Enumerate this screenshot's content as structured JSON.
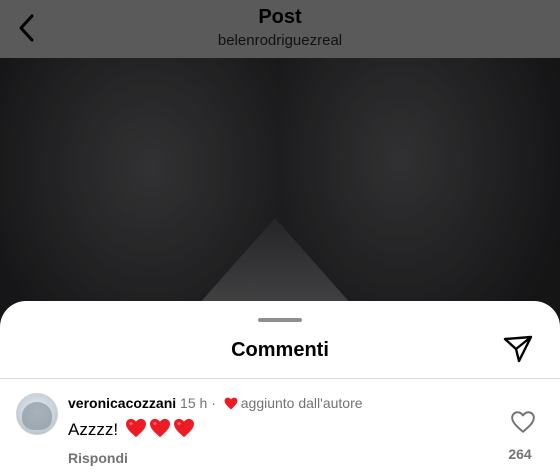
{
  "header": {
    "title": "Post",
    "subtitle": "belenrodriguezreal",
    "back_icon": "chevron-left-icon"
  },
  "colors": {
    "header_bg": "#5a5a5a",
    "heart_red": "#ed1c24",
    "muted": "#737373"
  },
  "sheet": {
    "title": "Commenti",
    "send_icon": "paper-plane-icon"
  },
  "comment": {
    "username": "veronicacozzani",
    "time": "15 h",
    "separator": "·",
    "author_like_label": "aggiunto dall'autore",
    "text": "Azzzz!",
    "emoji_count": 3,
    "reply_label": "Rispondi",
    "like_count": "264"
  }
}
